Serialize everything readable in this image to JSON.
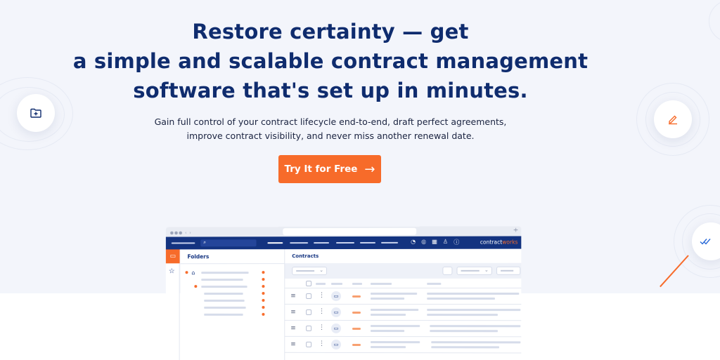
{
  "hero": {
    "headline_line1": "Restore certainty — get",
    "headline_line2": "a simple and scalable contract management",
    "headline_line3": "software that's set up in minutes.",
    "subtext_line1": "Gain full control of your contract lifecycle end-to-end, draft perfect agreements,",
    "subtext_line2": "improve contract visibility, and never miss another renewal date.",
    "cta_label": "Try It for Free",
    "cta_arrow": "→"
  },
  "floating_icons": {
    "left": "folder-plus-icon",
    "right": "pencil-icon",
    "far_right": "double-check-icon"
  },
  "mock_app": {
    "brand_prefix": "contract",
    "brand_suffix": "works",
    "folders_title": "Folders",
    "contracts_title": "Contracts",
    "rows": [
      1,
      2,
      3,
      4
    ]
  },
  "colors": {
    "accent": "#f76b2a",
    "navy": "#133380",
    "hero_bg": "#f3f5fb"
  }
}
